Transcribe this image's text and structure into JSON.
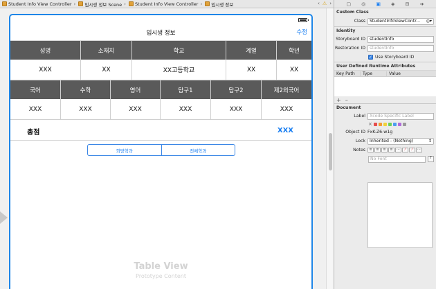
{
  "jumpbar": {
    "items": [
      "Student Info View Controller",
      "입시생 정보 Scene",
      "Student Info View Controller",
      "입시생 정보"
    ],
    "separator": "›",
    "nav_left": "‹",
    "warning_icon": "⚠",
    "nav_right": "›"
  },
  "scene": {
    "title": "입시생 정보",
    "edit_button": "수정",
    "table1": {
      "headers": [
        "성명",
        "소재지",
        "학교",
        "계열",
        "학년"
      ],
      "values": [
        "XXX",
        "XX",
        "XX고등학교",
        "XX",
        "XX"
      ]
    },
    "table2": {
      "headers": [
        "국어",
        "수학",
        "영어",
        "탐구1",
        "탐구2",
        "제2외국어"
      ],
      "values": [
        "XXX",
        "XXX",
        "XXX",
        "XXX",
        "XXX",
        "XXX"
      ]
    },
    "total": {
      "label": "총점",
      "value": "XXX"
    },
    "segments": [
      "희망학과",
      "전체학과"
    ],
    "table_view": {
      "title": "Table View",
      "subtitle": "Prototype Content"
    }
  },
  "inspector": {
    "toolbar_icons": [
      "file-icon",
      "help-icon",
      "identity-icon",
      "attributes-icon",
      "size-icon",
      "connections-icon"
    ],
    "custom_class": {
      "heading": "Custom Class",
      "class_label": "Class",
      "class_value": "StudentInfoViewContr..."
    },
    "identity": {
      "heading": "Identity",
      "storyboard_id_label": "Storyboard ID",
      "storyboard_id_value": "studentInfo",
      "restoration_id_label": "Restoration ID",
      "restoration_id_placeholder": "studentInfo",
      "use_storyboard_id_label": "Use Storyboard ID",
      "use_storyboard_id_checked": true
    },
    "runtime_attributes": {
      "heading": "User Defined Runtime Attributes",
      "columns": [
        "Key Path",
        "Type",
        "Value"
      ],
      "add": "+",
      "remove": "–"
    },
    "document": {
      "heading": "Document",
      "label_label": "Label",
      "label_placeholder": "Xcode Specific Label",
      "clear_mark": "×",
      "swatch_colors": [
        "#e64b4b",
        "#f39b32",
        "#f1d23a",
        "#6ccf5a",
        "#4c9df0",
        "#b06ad9",
        "#9a9a9a"
      ],
      "object_id_label": "Object ID",
      "object_id_value": "FxK-Z6-w1g",
      "lock_label": "Lock",
      "lock_value": "Inherited - (Nothing)",
      "notes_label": "Notes",
      "font_placeholder": "No Font"
    }
  }
}
